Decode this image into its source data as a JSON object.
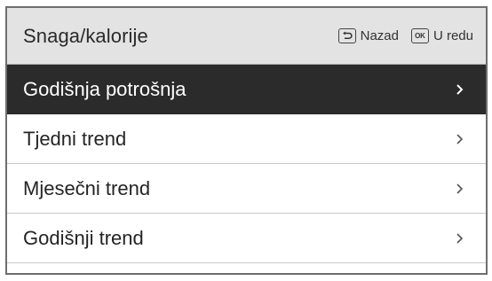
{
  "header": {
    "title": "Snaga/kalorije",
    "back_label": "Nazad",
    "back_icon": "back-key-icon",
    "ok_label": "U redu",
    "ok_icon_text": "OK"
  },
  "menu": {
    "items": [
      {
        "label": "Godišnja potrošnja",
        "selected": true
      },
      {
        "label": "Tjedni trend",
        "selected": false
      },
      {
        "label": "Mjesečni trend",
        "selected": false
      },
      {
        "label": "Godišnji trend",
        "selected": false
      }
    ]
  },
  "colors": {
    "header_bg": "#e3e3e3",
    "selected_bg": "#2b2b2b",
    "selected_text": "#ffffff",
    "text": "#242424"
  }
}
